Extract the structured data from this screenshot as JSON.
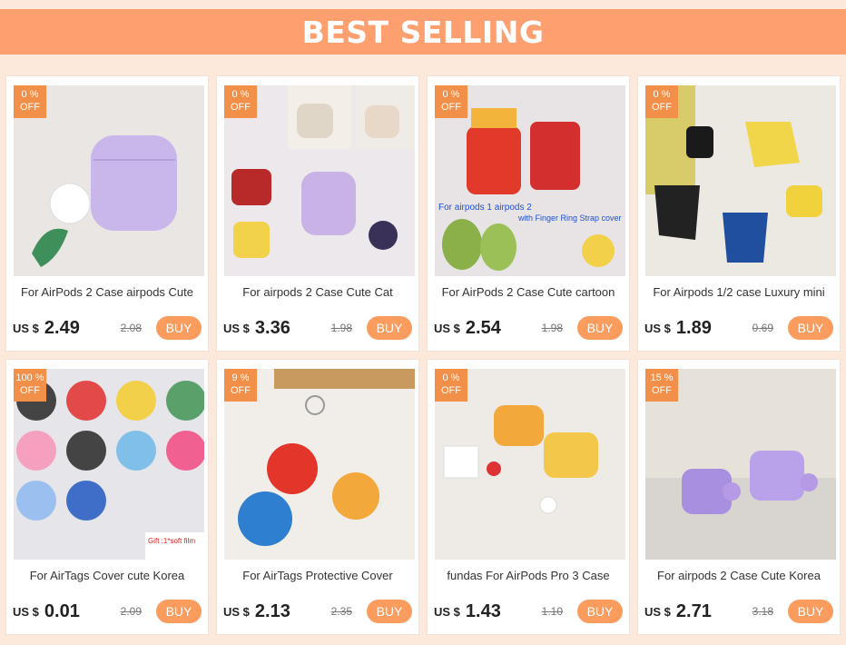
{
  "header": {
    "title": "BEST SELLING"
  },
  "products": [
    {
      "discount": "0 %",
      "off": "OFF",
      "title": "For AirPods 2 Case airpods Cute",
      "currency": "US $",
      "price": "2.49",
      "old_price": "2.08",
      "buy_label": "BUY",
      "image": "lilac-airpods-case",
      "bg": "#e9e6e4",
      "accent": "#c9b6ea"
    },
    {
      "discount": "0 %",
      "off": "OFF",
      "title": "For airpods 2 Case Cute Cat",
      "currency": "US $",
      "price": "3.36",
      "old_price": "1.98",
      "buy_label": "BUY",
      "image": "cat-keychain-cases-collage",
      "bg": "#ece8ec",
      "accent": "#c8b2e6"
    },
    {
      "discount": "0 %",
      "off": "OFF",
      "title": "For AirPods 2 Case Cute cartoon",
      "currency": "US $",
      "price": "2.54",
      "old_price": "1.98",
      "buy_label": "BUY",
      "image": "fries-popcorn-cases",
      "bg": "#e8e4e6",
      "accent": "#e23a2a",
      "overlay_text": [
        "For airpods 1 airpods 2",
        "with Finger Ring Strap cover"
      ]
    },
    {
      "discount": "0 %",
      "off": "OFF",
      "title": "For Airpods 1/2 case Luxury mini",
      "currency": "US $",
      "price": "1.89",
      "old_price": "0.69",
      "buy_label": "BUY",
      "image": "mini-tote-bag-cases",
      "bg": "#ece8e2",
      "accent": "#f2d64a"
    },
    {
      "discount": "100 %",
      "off": "OFF",
      "title": "For AirTags Cover cute Korea",
      "currency": "US $",
      "price": "0.01",
      "old_price": "2.09",
      "buy_label": "BUY",
      "image": "airtag-covers-assorted",
      "bg": "#e6e6ea",
      "accent": "#f07090",
      "overlay_text": [
        "Gift :1*soft film"
      ]
    },
    {
      "discount": "9 %",
      "off": "OFF",
      "title": "For AirTags Protective Cover",
      "currency": "US $",
      "price": "2.13",
      "old_price": "2.35",
      "buy_label": "BUY",
      "image": "candy-airtag-keychains",
      "bg": "#f1ede8",
      "accent": "#e3352a"
    },
    {
      "discount": "0 %",
      "off": "OFF",
      "title": "fundas For AirPods Pro 3 Case",
      "currency": "US $",
      "price": "1.43",
      "old_price": "1.10",
      "buy_label": "BUY",
      "image": "yellow-airpods-pro-cases",
      "bg": "#eeeae6",
      "accent": "#f3c84a"
    },
    {
      "discount": "15 %",
      "off": "OFF",
      "title": "For airpods 2 Case Cute Korea",
      "currency": "US $",
      "price": "2.71",
      "old_price": "3.18",
      "buy_label": "BUY",
      "image": "purple-bear-airpods-pro",
      "bg": "#d8d4d0",
      "accent": "#a98fe0"
    }
  ],
  "colors": {
    "banner": "#fd9f6e",
    "badge": "#f28f49",
    "buy_button": "#f99c5d",
    "page_bg": "#fde9db"
  }
}
